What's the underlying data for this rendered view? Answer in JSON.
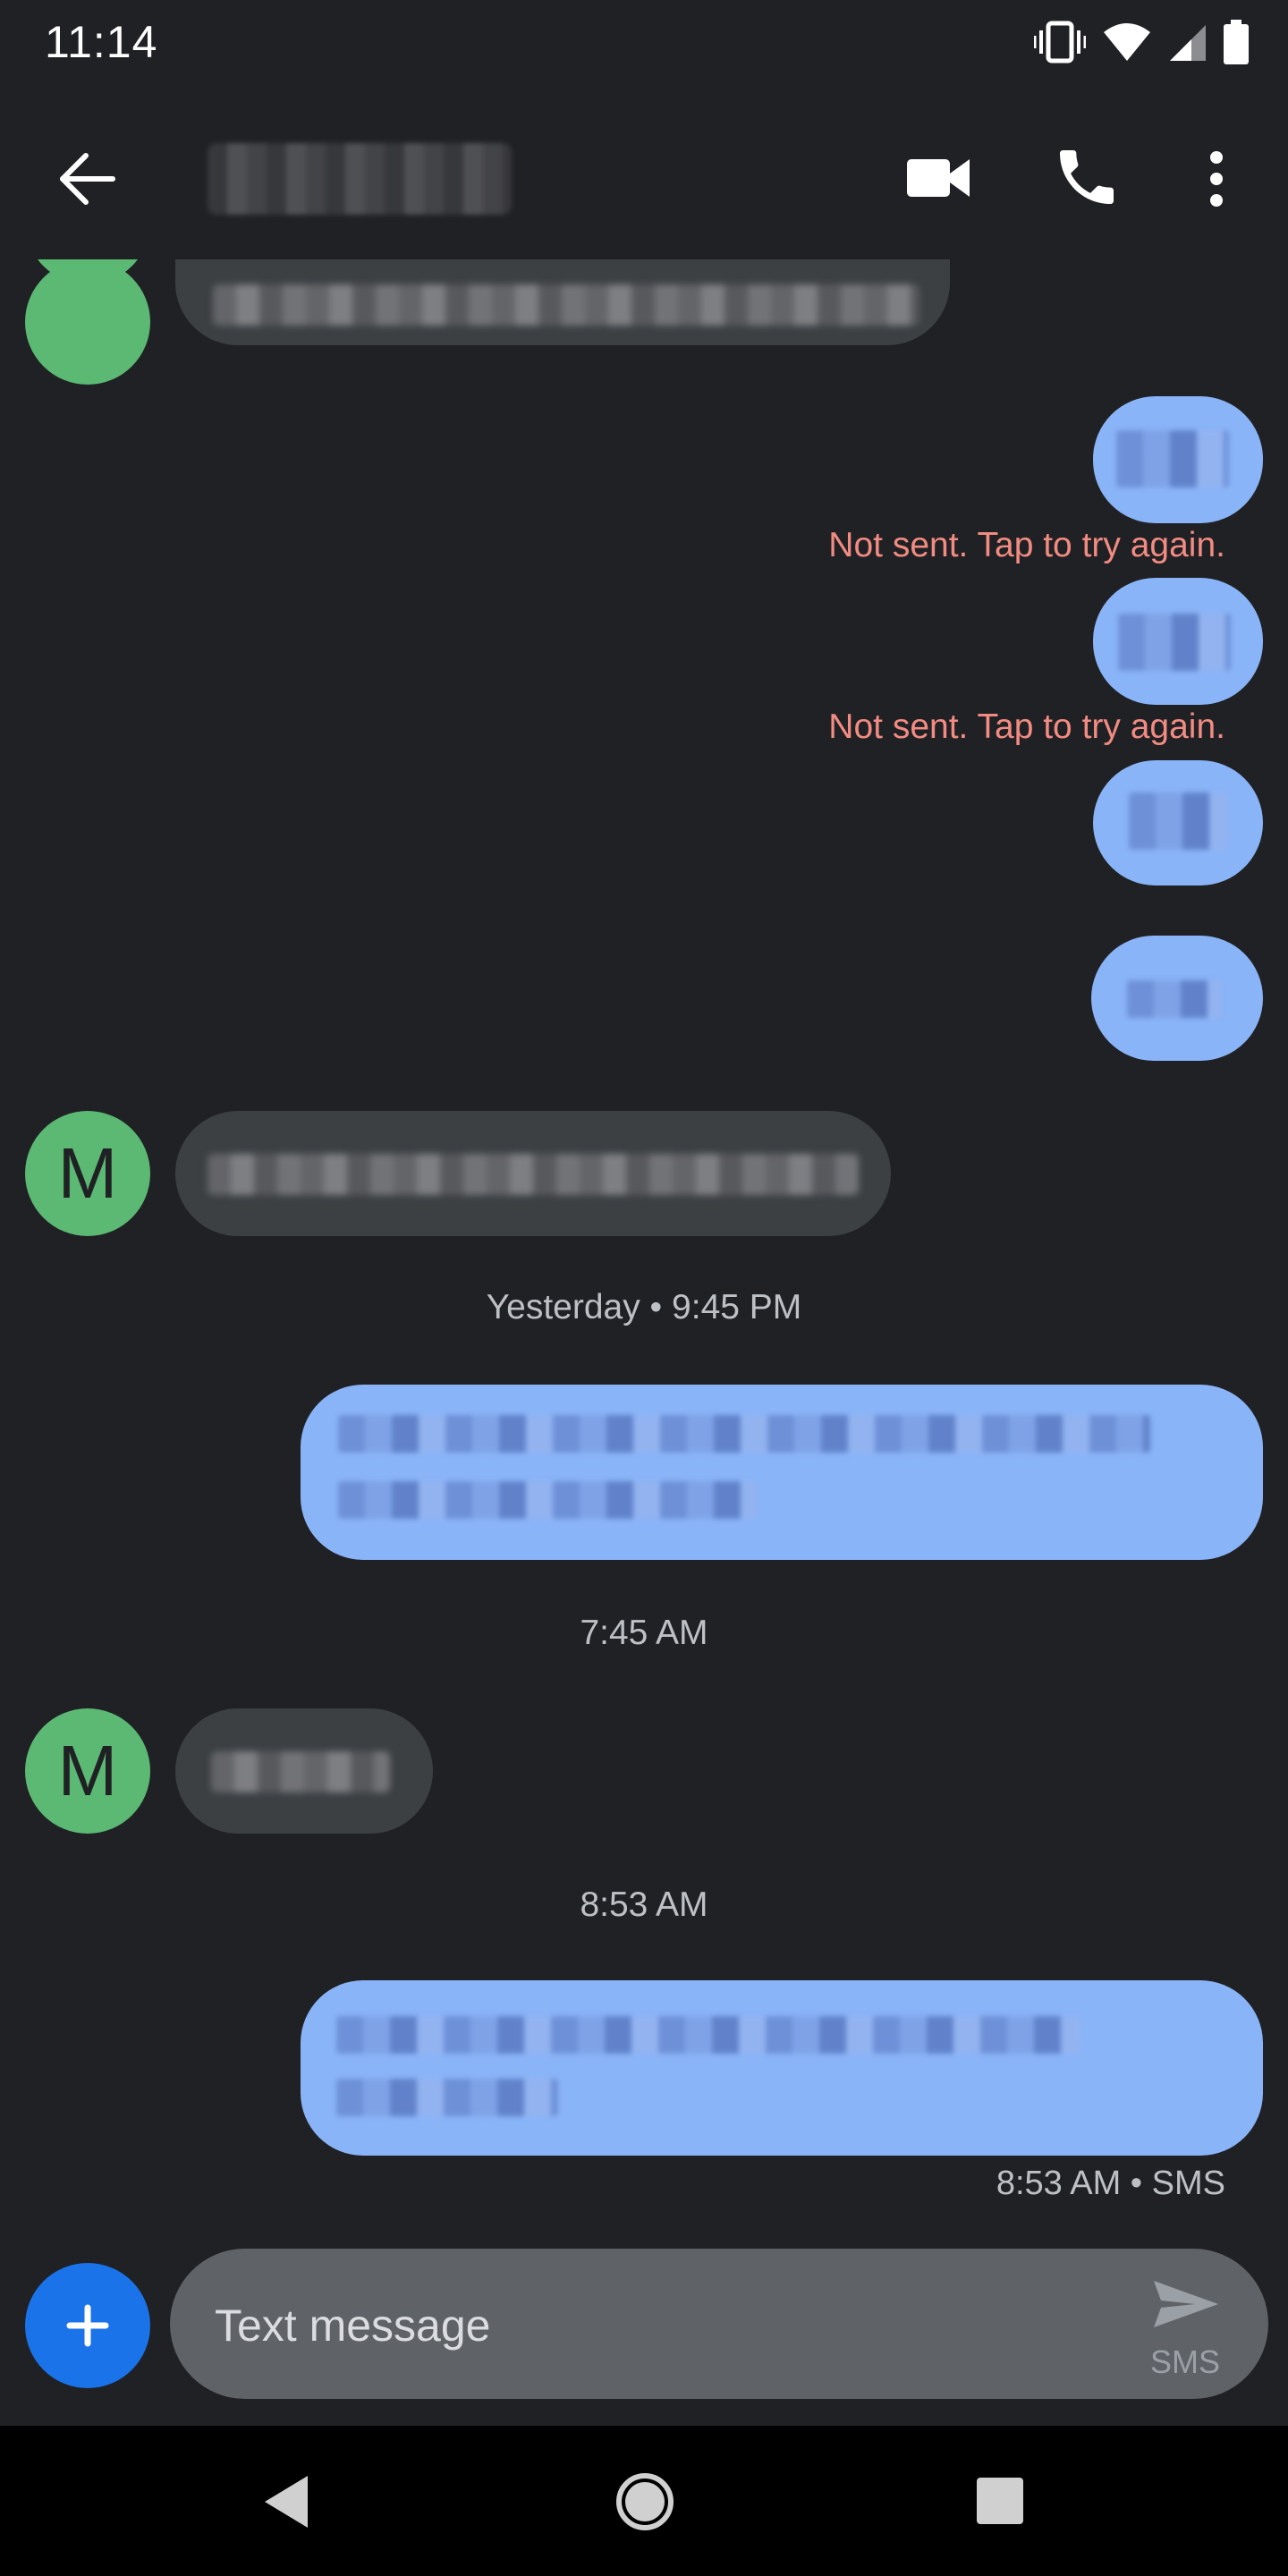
{
  "status_bar": {
    "time": "11:14",
    "icons": [
      "vibrate-icon",
      "wifi-icon",
      "signal-icon",
      "battery-icon"
    ]
  },
  "app_bar": {
    "contact_name": "redacted",
    "icons": [
      "back-arrow-icon",
      "video-call-icon",
      "phone-icon",
      "more-vert-icon"
    ]
  },
  "conversation": {
    "avatar_letter": "M",
    "error_text": "Not sent. Tap to try again.",
    "timestamps": {
      "yesterday": "Yesterday • 9:45 PM",
      "morning": "7:45 AM",
      "later": "8:53 AM"
    },
    "last_message_meta": "8:53 AM • SMS"
  },
  "compose": {
    "placeholder": "Text message",
    "send_label": "SMS"
  },
  "nav_bar": {
    "icons": [
      "nav-back-icon",
      "nav-home-icon",
      "nav-recents-icon"
    ]
  },
  "colors": {
    "background": "#202124",
    "incoming_bubble": "#3c4043",
    "outgoing_bubble": "#8ab4f8",
    "avatar": "#5bb974",
    "error": "#f28b82",
    "add_button": "#1a73e8"
  }
}
